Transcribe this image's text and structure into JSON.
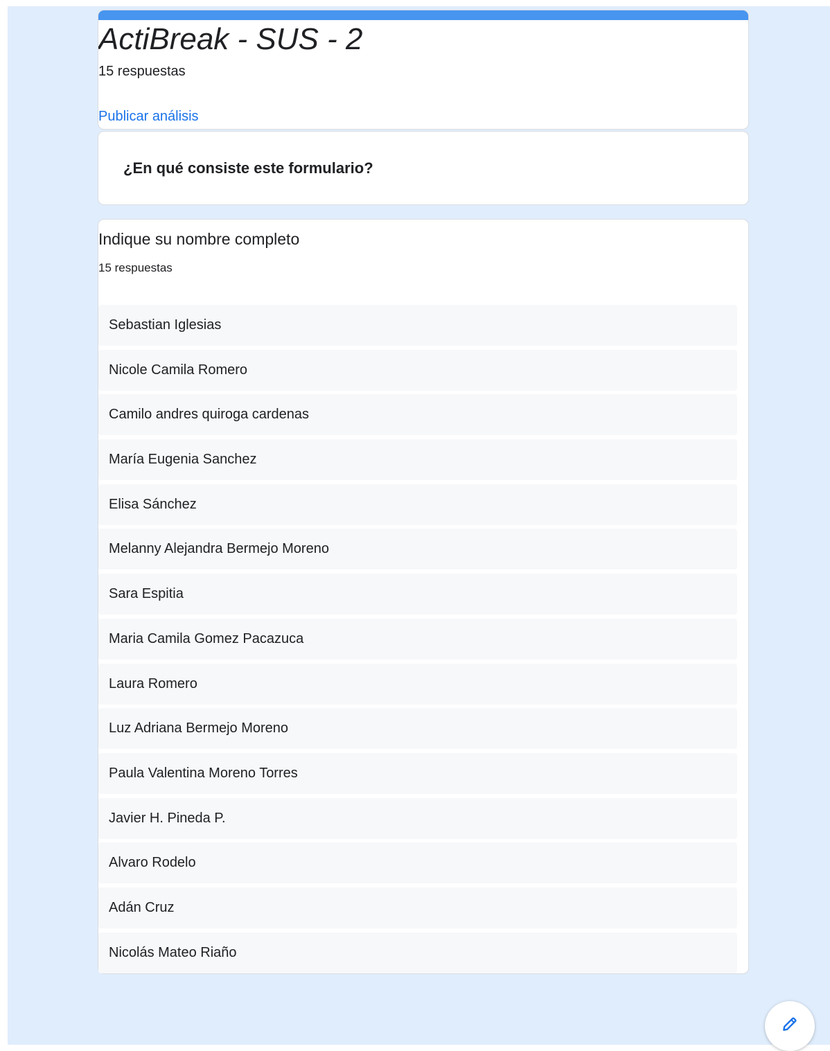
{
  "form": {
    "title": "ActiBreak - SUS - 2",
    "response_count": "15 respuestas",
    "publish_link": "Publicar análisis",
    "accent_color": "#4795ef"
  },
  "info": {
    "label": "¿En qué consiste este formulario?"
  },
  "question": {
    "title": "Indique su nombre completo",
    "response_count": "15 respuestas",
    "answers": [
      "Sebastian Iglesias",
      "Nicole Camila Romero",
      "Camilo andres quiroga cardenas",
      "María Eugenia Sanchez",
      "Elisa Sánchez",
      "Melanny Alejandra Bermejo Moreno",
      "Sara Espitia",
      "Maria Camila Gomez Pacazuca",
      "Laura Romero",
      "Luz Adriana Bermejo Moreno",
      "Paula Valentina Moreno Torres",
      "Javier H. Pineda P.",
      "Alvaro Rodelo",
      "Adán Cruz",
      "Nicolás Mateo Riaño"
    ]
  },
  "fab": {
    "icon": "pencil-icon",
    "icon_color": "#1a73e8"
  }
}
